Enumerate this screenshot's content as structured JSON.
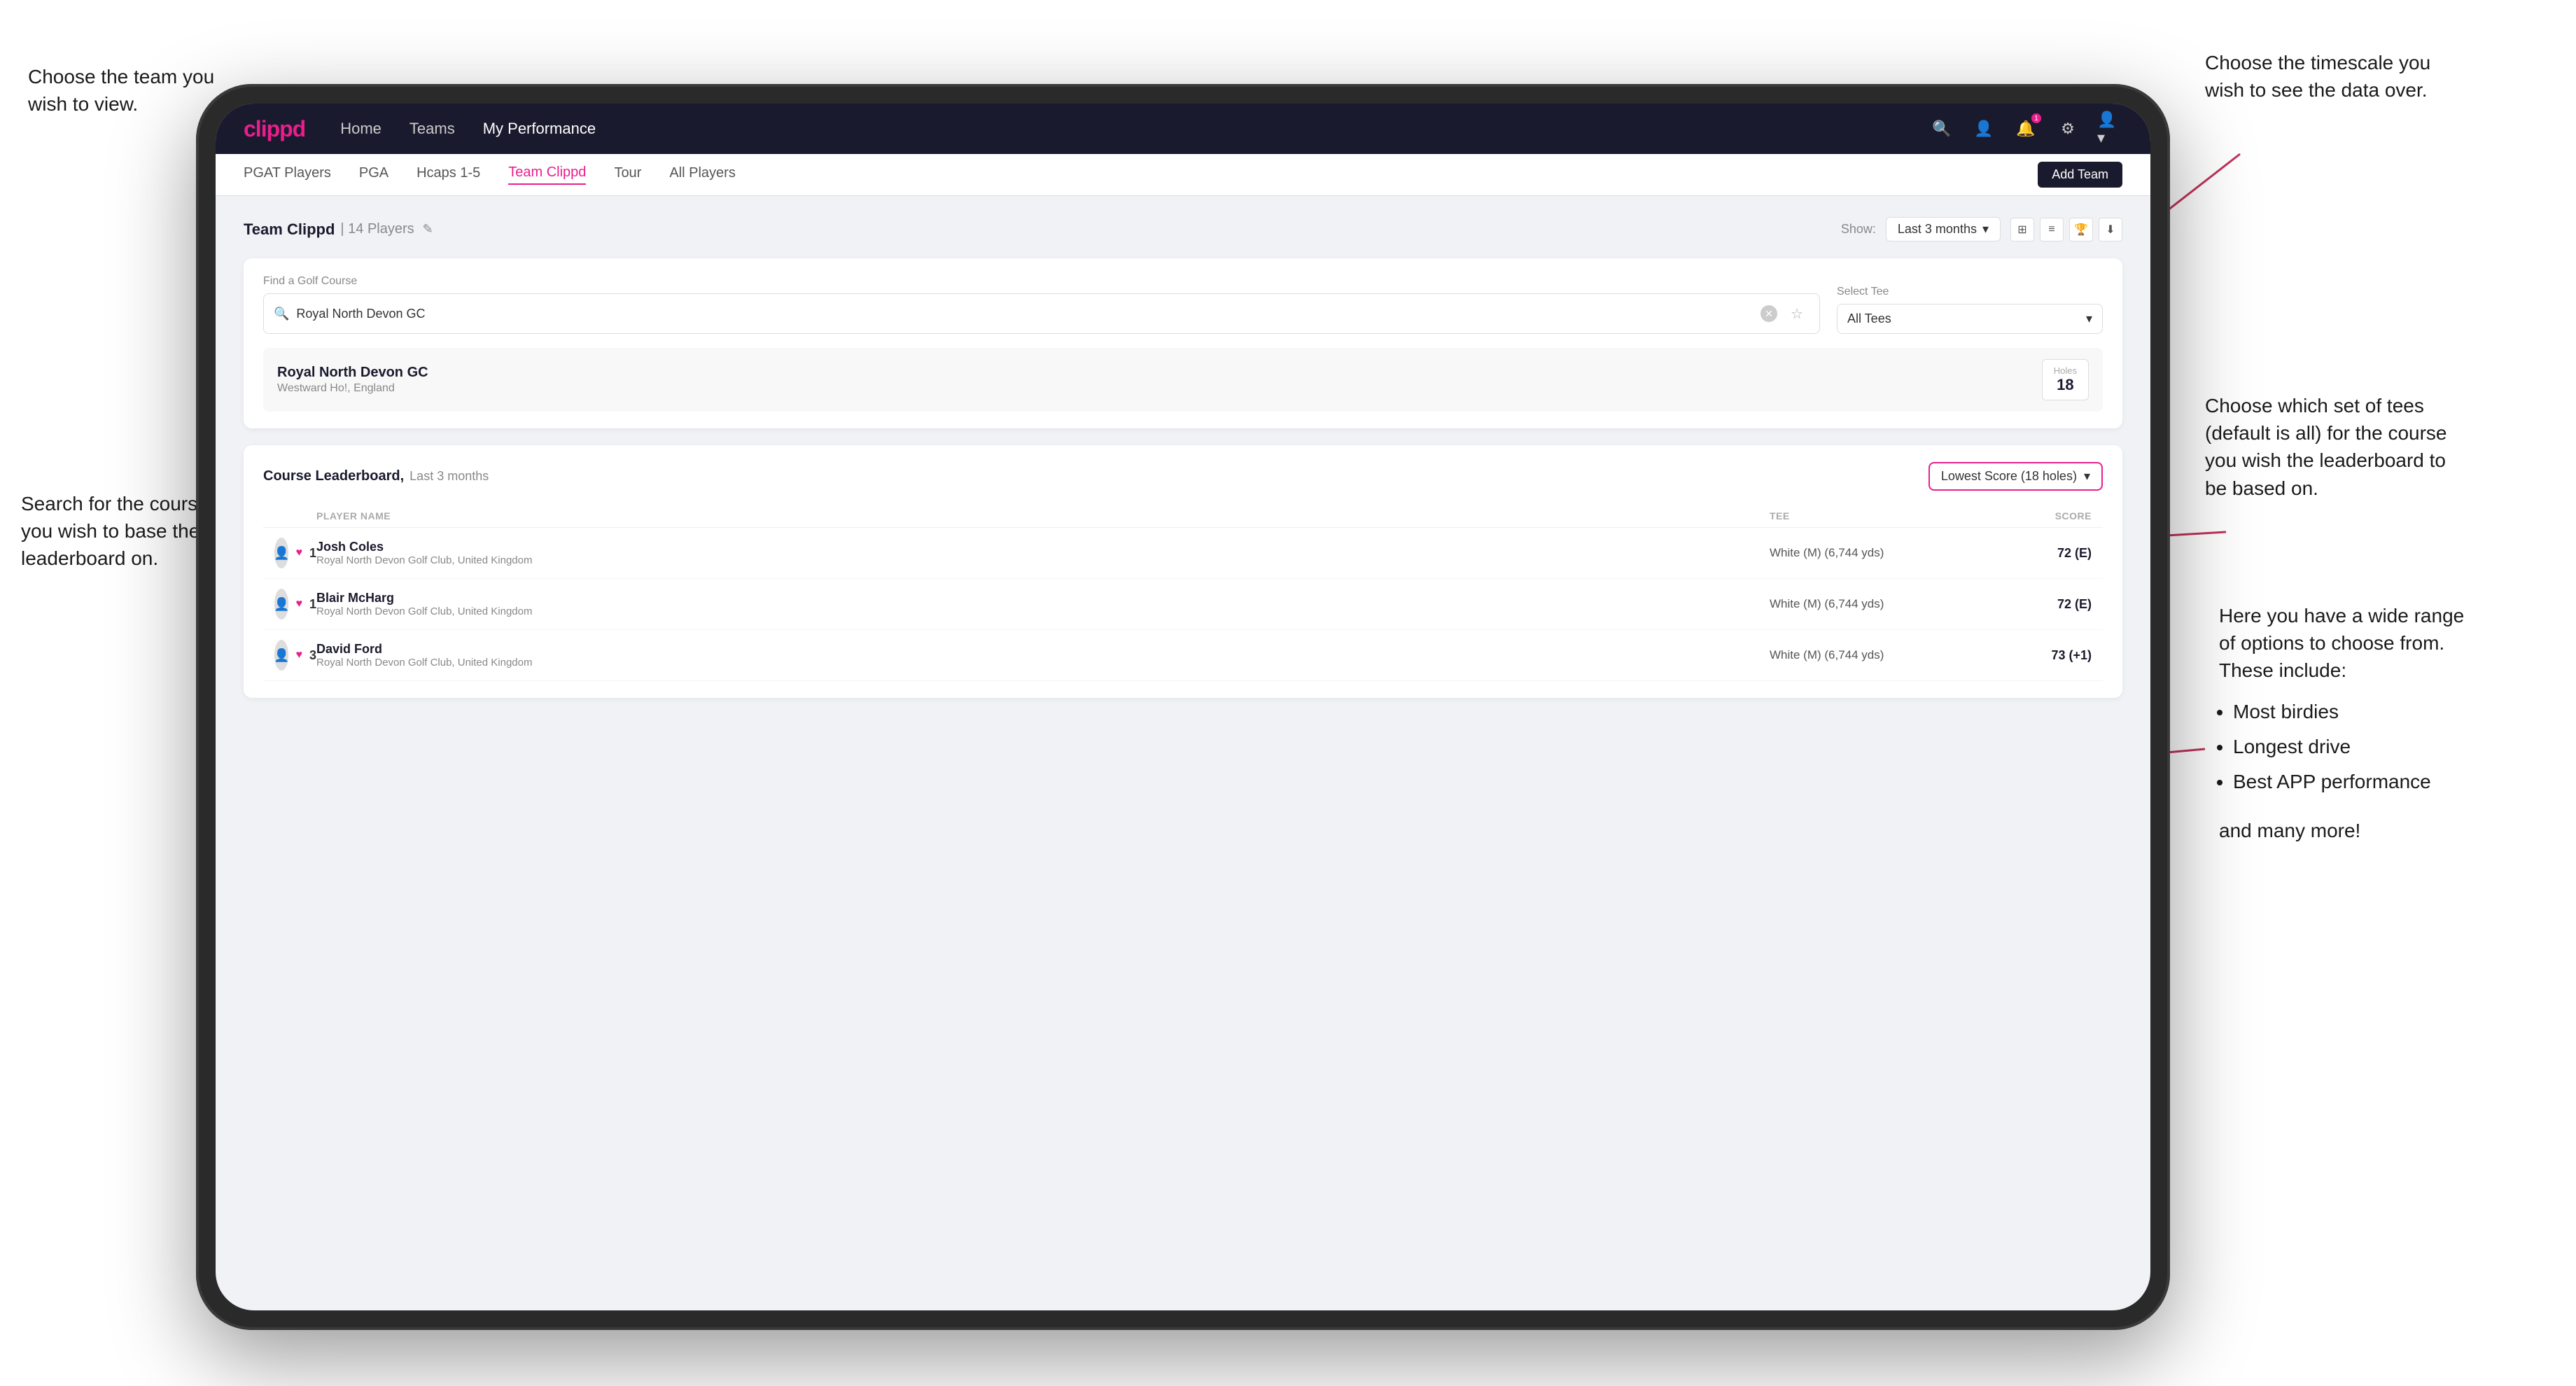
{
  "annotations": {
    "top_left": {
      "line1": "Choose the team you",
      "line2": "wish to view."
    },
    "mid_left": {
      "line1": "Search for the course",
      "line2": "you wish to base the",
      "line3": "leaderboard on."
    },
    "top_right": {
      "line1": "Choose the timescale you",
      "line2": "wish to see the data over."
    },
    "mid_right": {
      "line1": "Choose which set of tees",
      "line2": "(default is all) for the course",
      "line3": "you wish the leaderboard to",
      "line4": "be based on."
    },
    "bottom_right": {
      "line1": "Here you have a wide range",
      "line2": "of options to choose from.",
      "line3": "These include:",
      "bullets": [
        "Most birdies",
        "Longest drive",
        "Best APP performance"
      ],
      "and_more": "and many more!"
    }
  },
  "navbar": {
    "logo": "clippd",
    "nav_items": [
      "Home",
      "Teams",
      "My Performance"
    ],
    "active_nav": "My Performance"
  },
  "sub_navbar": {
    "items": [
      "PGAT Players",
      "PGA",
      "Hcaps 1-5",
      "Team Clippd",
      "Tour",
      "All Players"
    ],
    "active": "Team Clippd",
    "add_team_label": "Add Team"
  },
  "team_header": {
    "title": "Team Clippd",
    "count": "14 Players",
    "show_label": "Show:",
    "period": "Last 3 months"
  },
  "search_section": {
    "find_label": "Find a Golf Course",
    "find_placeholder": "Royal North Devon GC",
    "tee_label": "Select Tee",
    "tee_value": "All Tees"
  },
  "course_result": {
    "name": "Royal North Devon GC",
    "location": "Westward Ho!, England",
    "holes_label": "Holes",
    "holes_value": "18"
  },
  "leaderboard": {
    "title": "Course Leaderboard,",
    "period": "Last 3 months",
    "score_option": "Lowest Score (18 holes)",
    "col_headers": [
      "",
      "PLAYER NAME",
      "TEE",
      "SCORE"
    ],
    "players": [
      {
        "rank": "1",
        "name": "Josh Coles",
        "club": "Royal North Devon Golf Club, United Kingdom",
        "tee": "White (M) (6,744 yds)",
        "score": "72 (E)"
      },
      {
        "rank": "1",
        "name": "Blair McHarg",
        "club": "Royal North Devon Golf Club, United Kingdom",
        "tee": "White (M) (6,744 yds)",
        "score": "72 (E)"
      },
      {
        "rank": "3",
        "name": "David Ford",
        "club": "Royal North Devon Golf Club, United Kingdom",
        "tee": "White (M) (6,744 yds)",
        "score": "73 (+1)"
      }
    ]
  }
}
